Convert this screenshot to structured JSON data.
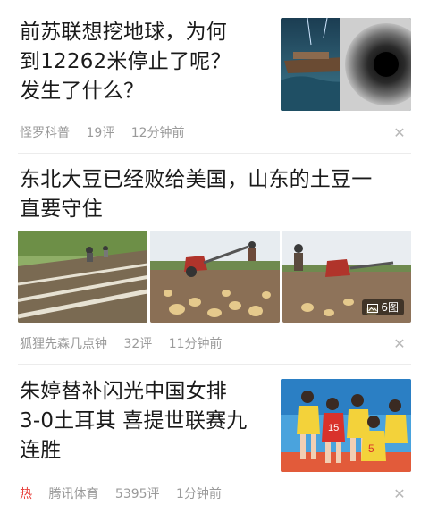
{
  "feed": [
    {
      "title_lines": [
        "前苏联想挖地球，为何",
        "到12262米停止了呢？",
        "发生了什么？"
      ],
      "source": "怪罗科普",
      "comments": "19评",
      "time": "12分钟前"
    },
    {
      "title_lines": [
        "东北大豆已经败给美国，山东的土豆一",
        "直要守住"
      ],
      "source": "狐狸先森几点钟",
      "comments": "32评",
      "time": "11分钟前",
      "image_count": "6图"
    },
    {
      "title_lines": [
        "朱婷替补闪光中国女排",
        "3-0土耳其 喜提世联赛九",
        "连胜"
      ],
      "hot_label": "热",
      "source": "腾讯体育",
      "comments": "5395评",
      "time": "1分钟前"
    }
  ],
  "icons": {
    "dismiss": "close-icon",
    "gallery": "image-gallery-icon"
  },
  "colors": {
    "hot": "#e8413c",
    "meta": "#9a9a9a",
    "divider": "#ececec"
  }
}
